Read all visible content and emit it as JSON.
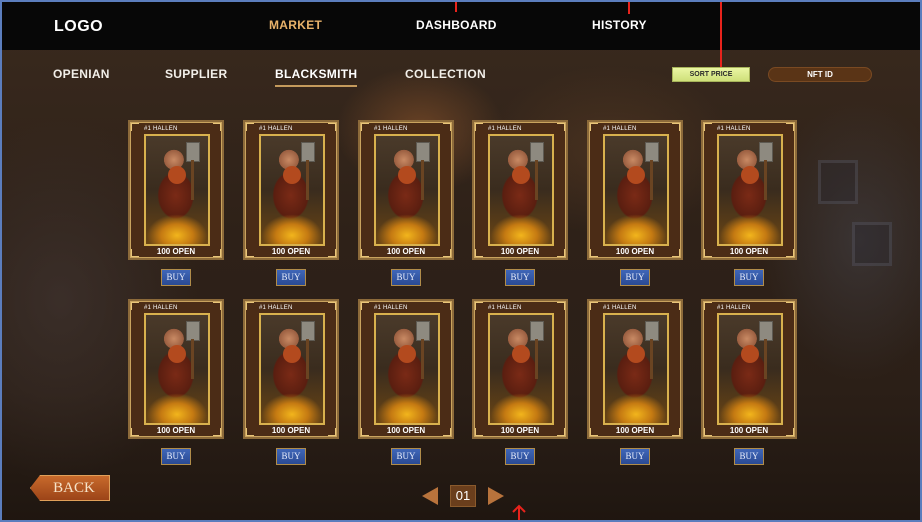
{
  "colors": {
    "active_nav": "#e8b26a",
    "topbar_bg": "#070707",
    "sort_btn_bg": "#dfeb8e",
    "nft_btn_bg": "#5a3416",
    "buy_btn_bg": "#3358a8",
    "back_btn_bg": "#b4582a",
    "annotation_red": "#e8231c"
  },
  "header": {
    "logo": "LOGO",
    "nav": [
      "MARKET",
      "DASHBOARD",
      "HISTORY"
    ],
    "active": "MARKET"
  },
  "subnav": {
    "items": [
      "OPENIAN",
      "SUPPLIER",
      "BLACKSMITH",
      "COLLECTION"
    ],
    "active": "BLACKSMITH"
  },
  "filters": {
    "sort_label": "SORT PRICE",
    "nftid_label": "NFT ID"
  },
  "cards": [
    {
      "name": "#1 HALLEN",
      "price": "100 OPEN",
      "buy": "BUY"
    },
    {
      "name": "#1 HALLEN",
      "price": "100 OPEN",
      "buy": "BUY"
    },
    {
      "name": "#1 HALLEN",
      "price": "100 OPEN",
      "buy": "BUY"
    },
    {
      "name": "#1 HALLEN",
      "price": "100 OPEN",
      "buy": "BUY"
    },
    {
      "name": "#1 HALLEN",
      "price": "100 OPEN",
      "buy": "BUY"
    },
    {
      "name": "#1 HALLEN",
      "price": "100 OPEN",
      "buy": "BUY"
    },
    {
      "name": "#1 HALLEN",
      "price": "100 OPEN",
      "buy": "BUY"
    },
    {
      "name": "#1 HALLEN",
      "price": "100 OPEN",
      "buy": "BUY"
    },
    {
      "name": "#1 HALLEN",
      "price": "100 OPEN",
      "buy": "BUY"
    },
    {
      "name": "#1 HALLEN",
      "price": "100 OPEN",
      "buy": "BUY"
    },
    {
      "name": "#1 HALLEN",
      "price": "100 OPEN",
      "buy": "BUY"
    },
    {
      "name": "#1 HALLEN",
      "price": "100 OPEN",
      "buy": "BUY"
    }
  ],
  "pagination": {
    "page": "01",
    "prev_icon": "triangle-left-icon",
    "next_icon": "triangle-right-icon"
  },
  "back": {
    "label": "BACK"
  }
}
